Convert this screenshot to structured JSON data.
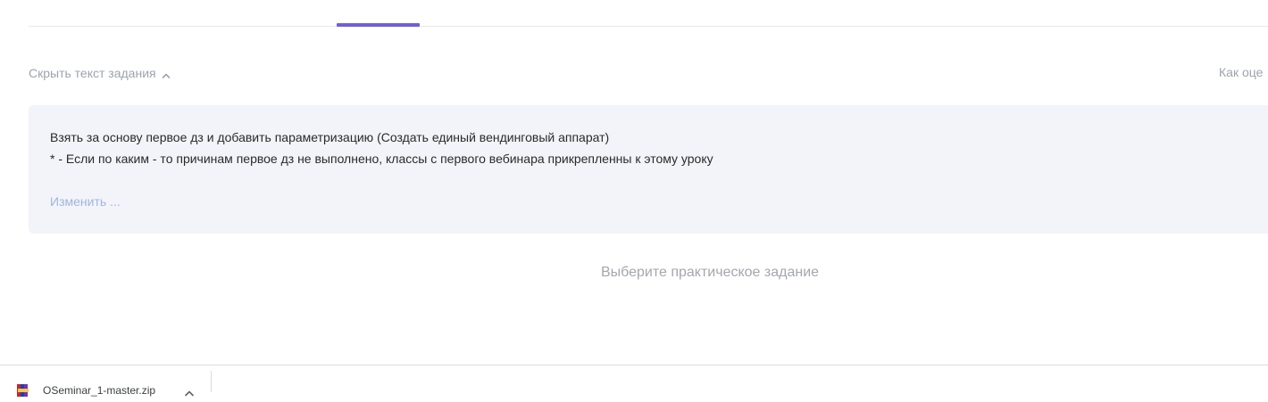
{
  "tabs": {
    "active_index": 1,
    "accent_color": "#6e5fd8"
  },
  "task": {
    "toggle_label": "Скрыть текст задания",
    "how_graded_label": "Как оце",
    "line1": "Взять за основу первое дз и добавить параметризацию (Создать единый вендинговый аппарат)",
    "line2": "* - Если по каким - то причинам первое дз не выполнено, классы с первого вебинара прикрепленны к этому уроку",
    "edit_label": "Изменить ..."
  },
  "empty_state": {
    "text": "Выберите практическое задание"
  },
  "downloads": {
    "items": [
      {
        "filename": "OSeminar_1-master.zip",
        "icon": "zip-archive-icon"
      }
    ]
  }
}
